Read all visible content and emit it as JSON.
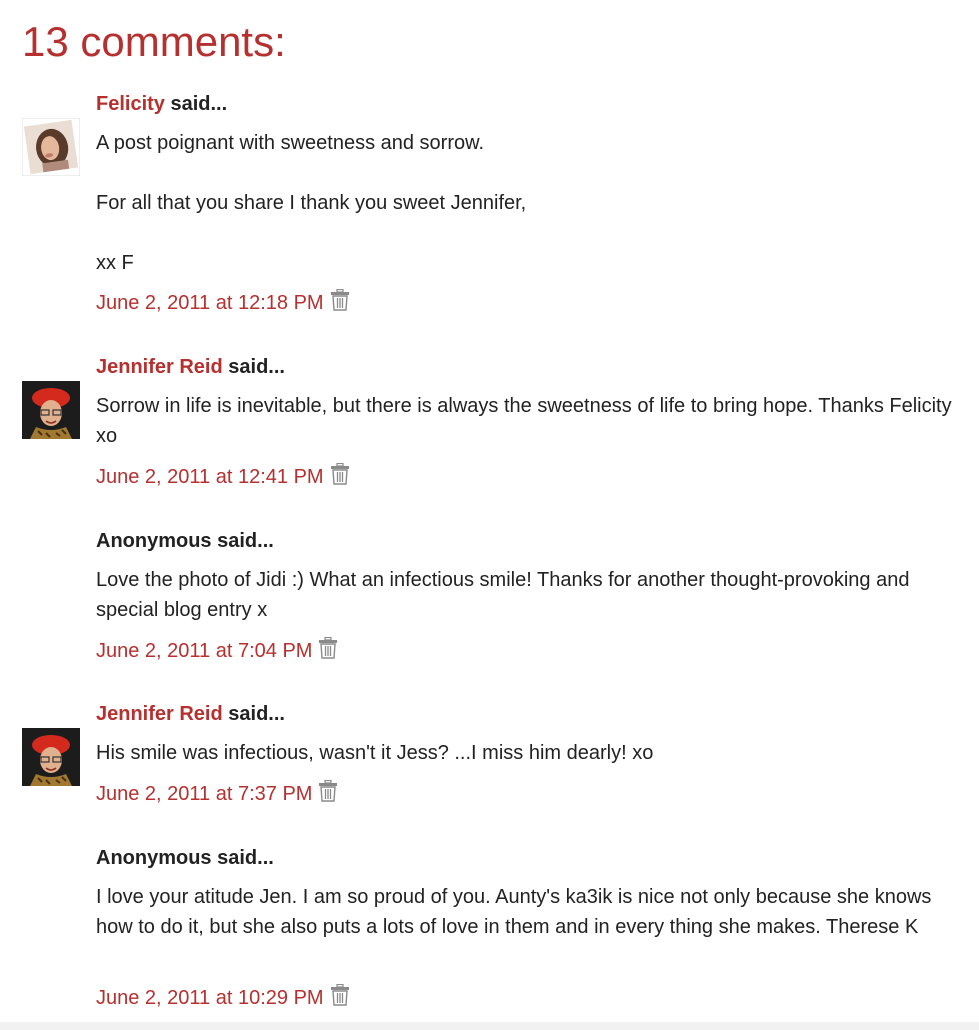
{
  "heading": "13 comments:",
  "said_label": "said...",
  "comments": [
    {
      "author": "Felicity",
      "author_is_link": true,
      "avatar": "felicity-photo",
      "paragraphs": [
        "A post poignant with sweetness and sorrow.",
        "For all that you share I thank you sweet Jennifer,",
        "xx F"
      ],
      "timestamp": "June 2, 2011 at 12:18 PM",
      "delete_icon": "trash-icon"
    },
    {
      "author": "Jennifer Reid",
      "author_is_link": true,
      "avatar": "jennifer-red-beret-photo",
      "paragraphs": [
        "Sorrow in life is inevitable, but there is always the sweetness of life to bring hope. Thanks Felicity xo"
      ],
      "timestamp": "June 2, 2011 at 12:41 PM",
      "delete_icon": "trash-icon"
    },
    {
      "author": "Anonymous",
      "author_is_link": false,
      "avatar": null,
      "paragraphs": [
        "Love the photo of Jidi :) What an infectious smile! Thanks for another thought-provoking and special blog entry x"
      ],
      "timestamp": "June 2, 2011 at 7:04 PM",
      "delete_icon": "trash-icon"
    },
    {
      "author": "Jennifer Reid",
      "author_is_link": true,
      "avatar": "jennifer-red-beret-photo",
      "paragraphs": [
        "His smile was infectious, wasn't it Jess? ...I miss him dearly! xo"
      ],
      "timestamp": "June 2, 2011 at 7:37 PM",
      "delete_icon": "trash-icon"
    },
    {
      "author": "Anonymous",
      "author_is_link": false,
      "avatar": null,
      "paragraphs": [
        "I love your atitude Jen. I am so proud of you. Aunty's ka3ik is nice not only because she knows how to do it, but she also puts a lots of love in them and in every thing she makes. Therese K"
      ],
      "timestamp": "June 2, 2011 at 10:29 PM",
      "delete_icon": "trash-icon"
    }
  ],
  "colors": {
    "accent": "#b5302e",
    "text": "#222222",
    "icon": "#8a8a8a"
  }
}
